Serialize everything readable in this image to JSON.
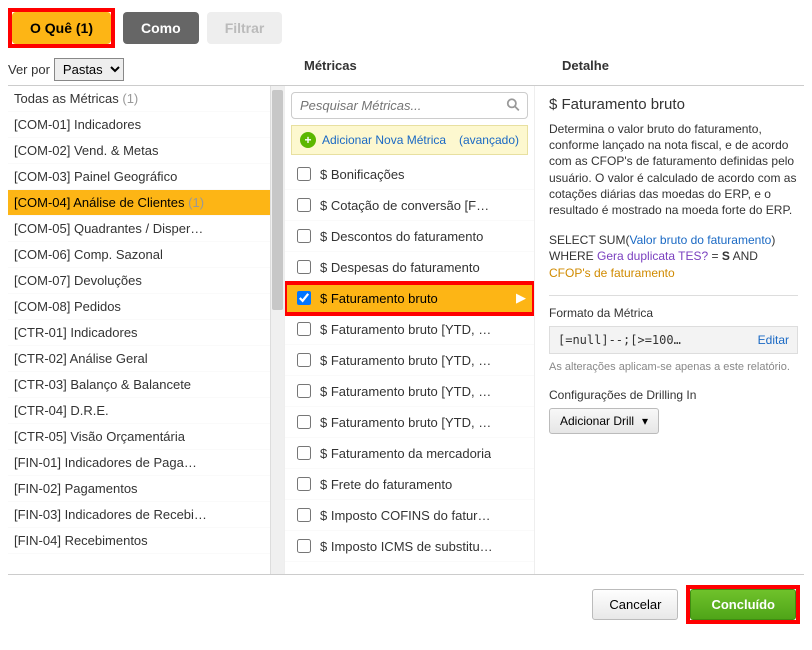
{
  "tabs": {
    "what_label": "O Quê (1)",
    "how_label": "Como",
    "filter_label": "Filtrar"
  },
  "verpor": {
    "label": "Ver por",
    "selected": "Pastas"
  },
  "headers": {
    "metrics": "Métricas",
    "detail": "Detalhe"
  },
  "folders": [
    {
      "label": "Todas as Métricas",
      "count": "(1)",
      "selected": false
    },
    {
      "label": "[COM-01] Indicadores",
      "selected": false
    },
    {
      "label": "[COM-02] Vend. & Metas",
      "selected": false
    },
    {
      "label": "[COM-03] Painel Geográfico",
      "selected": false
    },
    {
      "label": "[COM-04] Análise de Clientes",
      "count": "(1)",
      "selected": true
    },
    {
      "label": "[COM-05] Quadrantes / Disper…",
      "selected": false
    },
    {
      "label": "[COM-06] Comp. Sazonal",
      "selected": false
    },
    {
      "label": "[COM-07] Devoluções",
      "selected": false
    },
    {
      "label": "[COM-08] Pedidos",
      "selected": false
    },
    {
      "label": "[CTR-01] Indicadores",
      "selected": false
    },
    {
      "label": "[CTR-02] Análise Geral",
      "selected": false
    },
    {
      "label": "[CTR-03] Balanço & Balancete",
      "selected": false
    },
    {
      "label": "[CTR-04] D.R.E.",
      "selected": false
    },
    {
      "label": "[CTR-05] Visão Orçamentária",
      "selected": false
    },
    {
      "label": "[FIN-01] Indicadores de Paga…",
      "selected": false
    },
    {
      "label": "[FIN-02] Pagamentos",
      "selected": false
    },
    {
      "label": "[FIN-03] Indicadores de Recebi…",
      "selected": false
    },
    {
      "label": "[FIN-04] Recebimentos",
      "selected": false
    }
  ],
  "metrics": {
    "search_placeholder": "Pesquisar Métricas...",
    "add_label": "Adicionar Nova Métrica",
    "add_advanced": "(avançado)",
    "list": [
      {
        "label": "$ Bonificações",
        "checked": false,
        "selected": false
      },
      {
        "label": "$ Cotação de conversão [F…",
        "checked": false,
        "selected": false
      },
      {
        "label": "$ Descontos do faturamento",
        "checked": false,
        "selected": false
      },
      {
        "label": "$ Despesas do faturamento",
        "checked": false,
        "selected": false
      },
      {
        "label": "$ Faturamento bruto",
        "checked": true,
        "selected": true,
        "highlight": true
      },
      {
        "label": "$ Faturamento bruto [YTD, …",
        "checked": false,
        "selected": false
      },
      {
        "label": "$ Faturamento bruto [YTD, …",
        "checked": false,
        "selected": false
      },
      {
        "label": "$ Faturamento bruto [YTD, …",
        "checked": false,
        "selected": false
      },
      {
        "label": "$ Faturamento bruto [YTD, …",
        "checked": false,
        "selected": false
      },
      {
        "label": "$ Faturamento da mercadoria",
        "checked": false,
        "selected": false
      },
      {
        "label": "$ Frete do faturamento",
        "checked": false,
        "selected": false
      },
      {
        "label": "$ Imposto COFINS do fatur…",
        "checked": false,
        "selected": false
      },
      {
        "label": "$ Imposto ICMS de substitu…",
        "checked": false,
        "selected": false
      }
    ]
  },
  "detail": {
    "title": "$ Faturamento bruto",
    "description": "Determina o valor bruto do faturamento, conforme lançado na nota fiscal, e de acordo com as CFOP's de faturamento definidas pelo usuário. O valor é calculado de acordo com as cotações diárias das moedas do ERP, e o resultado é mostrado na moeda forte do ERP.",
    "sql": {
      "select": "SELECT SUM(",
      "field1": "Valor bruto do faturamento",
      "where": ") WHERE ",
      "field2": "Gera duplicata TES?",
      "eq": " = ",
      "val": "S",
      "and": " AND ",
      "field3": "CFOP's de faturamento"
    },
    "format_label": "Formato da Métrica",
    "format_value": "[=null]--;[>=100…",
    "format_edit": "Editar",
    "format_note": "As alterações aplicam-se apenas a este relatório.",
    "drill_label": "Configurações de Drilling In",
    "drill_button": "Adicionar Drill"
  },
  "footer": {
    "cancel": "Cancelar",
    "done": "Concluído"
  }
}
